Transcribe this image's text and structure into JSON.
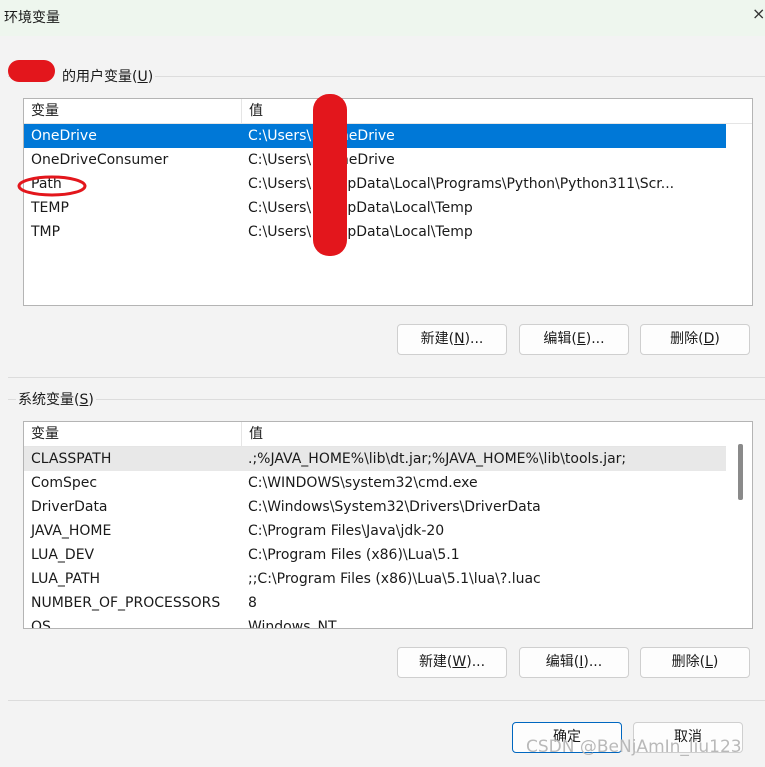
{
  "window": {
    "title": "环境变量",
    "close_glyph": "×"
  },
  "user_vars": {
    "legend_prefix": "",
    "legend": "的用户变量(",
    "legend_key": "U",
    "legend_suffix": ")",
    "columns": [
      "变量",
      "值"
    ],
    "rows": [
      {
        "name": "OneDrive",
        "value": "C:\\Users\\    e\\OneDrive",
        "selected": true
      },
      {
        "name": "OneDriveConsumer",
        "value": "C:\\Users\\    e\\OneDrive"
      },
      {
        "name": "Path",
        "value": "C:\\Users\\    e\\AppData\\Local\\Programs\\Python\\Python311\\Scr..."
      },
      {
        "name": "TEMP",
        "value": "C:\\Users\\    e\\AppData\\Local\\Temp"
      },
      {
        "name": "TMP",
        "value": "C:\\Users\\    e\\AppData\\Local\\Temp"
      }
    ],
    "buttons": {
      "new": {
        "pre": "新建(",
        "key": "N",
        "post": ")..."
      },
      "edit": {
        "pre": "编辑(",
        "key": "E",
        "post": ")..."
      },
      "delete": {
        "pre": "删除(",
        "key": "D",
        "post": ")"
      }
    }
  },
  "system_vars": {
    "legend": "系统变量(",
    "legend_key": "S",
    "legend_suffix": ")",
    "columns": [
      "变量",
      "值"
    ],
    "rows": [
      {
        "name": "CLASSPATH",
        "value": ".;%JAVA_HOME%\\lib\\dt.jar;%JAVA_HOME%\\lib\\tools.jar;"
      },
      {
        "name": "ComSpec",
        "value": "C:\\WINDOWS\\system32\\cmd.exe"
      },
      {
        "name": "DriverData",
        "value": "C:\\Windows\\System32\\Drivers\\DriverData"
      },
      {
        "name": "JAVA_HOME",
        "value": "C:\\Program Files\\Java\\jdk-20"
      },
      {
        "name": "LUA_DEV",
        "value": "C:\\Program Files (x86)\\Lua\\5.1"
      },
      {
        "name": "LUA_PATH",
        "value": ";;C:\\Program Files (x86)\\Lua\\5.1\\lua\\?.luac"
      },
      {
        "name": "NUMBER_OF_PROCESSORS",
        "value": "8"
      },
      {
        "name": "OS",
        "value": "Windows_NT"
      }
    ],
    "buttons": {
      "new": {
        "pre": "新建(",
        "key": "W",
        "post": ")..."
      },
      "edit": {
        "pre": "编辑(",
        "key": "I",
        "post": ")..."
      },
      "delete": {
        "pre": "删除(",
        "key": "L",
        "post": ")"
      }
    }
  },
  "footer": {
    "ok": "确定",
    "cancel": "取消"
  },
  "watermark": "CSDN @BeNjAmIn_liu123",
  "colors": {
    "selection": "#0078d7",
    "redaction": "#e3161c",
    "default_button_border": "#0067c0"
  }
}
